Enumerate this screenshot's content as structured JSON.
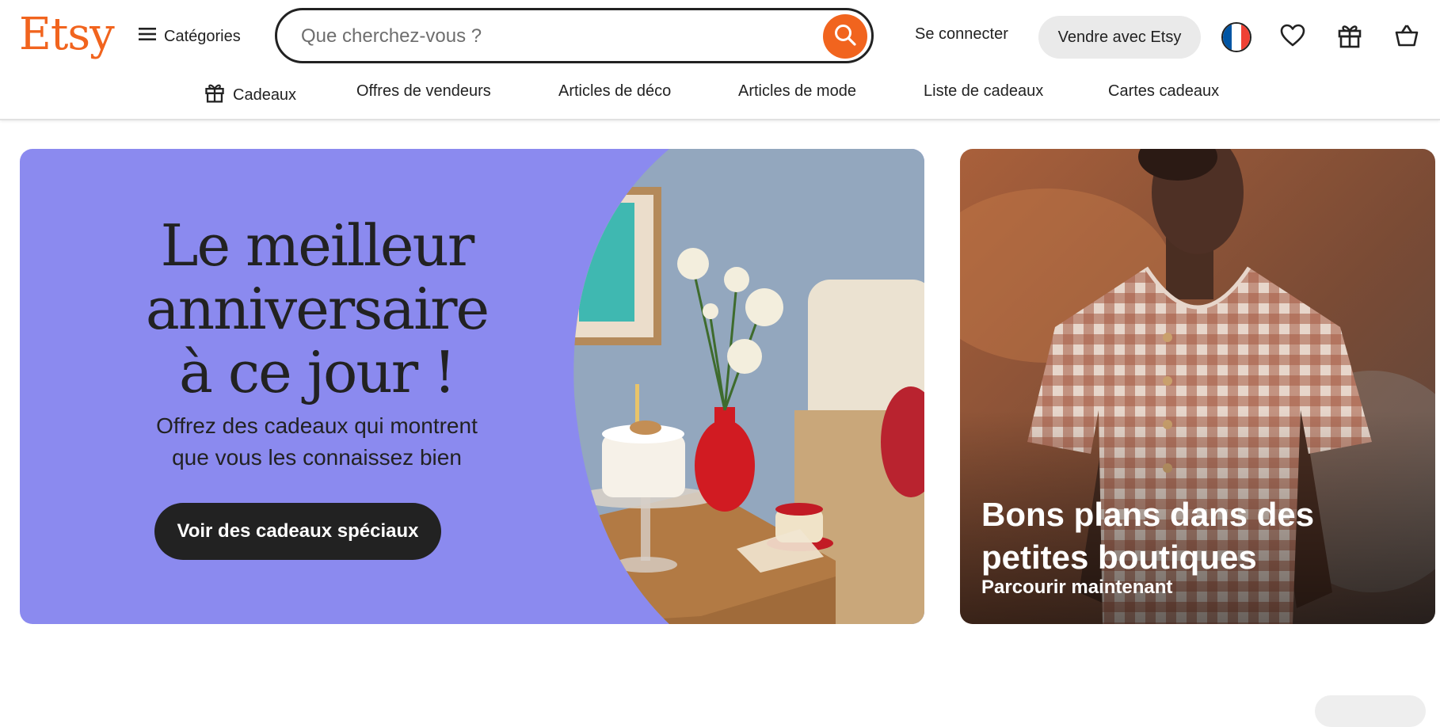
{
  "header": {
    "logo": "Etsy",
    "categories_label": "Catégories",
    "search_placeholder": "Que cherchez-vous ?",
    "search_value": "",
    "signin_label": "Se connecter",
    "sell_label": "Vendre avec Etsy",
    "icons": [
      "menu-icon",
      "search-icon",
      "france-flag-icon",
      "heart-icon",
      "gift-icon",
      "cart-icon"
    ]
  },
  "nav": {
    "items": [
      {
        "label": "Cadeaux",
        "icon": "gift-icon"
      },
      {
        "label": "Offres de vendeurs"
      },
      {
        "label": "Articles de déco"
      },
      {
        "label": "Articles de mode"
      },
      {
        "label": "Liste de cadeaux"
      },
      {
        "label": "Cartes cadeaux"
      }
    ]
  },
  "hero": {
    "title": "Le meilleur\nanniversaire\nà ce jour !",
    "subtitle": "Offrez des cadeaux qui montrent\nque vous les connaissez bien",
    "cta_label": "Voir des cadeaux spéciaux"
  },
  "promo": {
    "title": "Bons plans dans des\npetites boutiques",
    "link_label": "Parcourir maintenant"
  },
  "colors": {
    "brand": "#F1641E",
    "hero_bg": "#8B8AEF",
    "dark": "#222222"
  }
}
